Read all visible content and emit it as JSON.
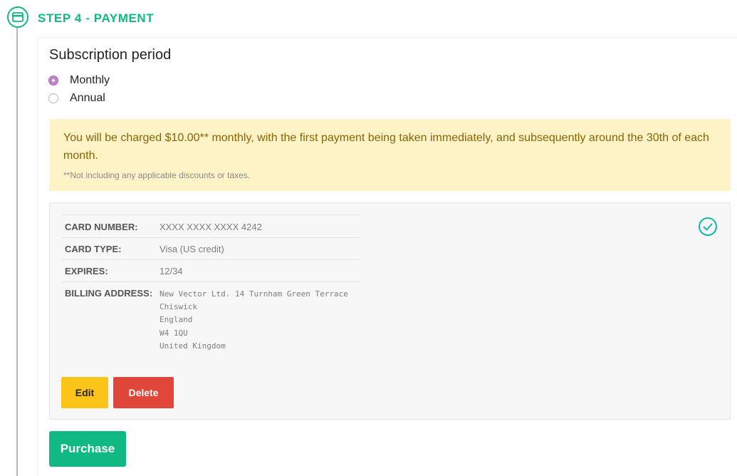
{
  "step": {
    "icon": "credit-card-icon",
    "title": "STEP 4 - PAYMENT"
  },
  "subscription": {
    "title": "Subscription period",
    "options": [
      {
        "label": "Monthly",
        "selected": true
      },
      {
        "label": "Annual",
        "selected": false
      }
    ]
  },
  "notice": {
    "message": "You will be charged $10.00** monthly, with the first payment being taken immediately, and subsequently around the 30th of each month.",
    "footnote": "**Not including any applicable discounts or taxes."
  },
  "card": {
    "rows": [
      {
        "label": "CARD NUMBER:",
        "value": "XXXX XXXX XXXX 4242"
      },
      {
        "label": "CARD TYPE:",
        "value": "Visa (US credit)"
      },
      {
        "label": "EXPIRES:",
        "value": "12/34"
      },
      {
        "label": "BILLING ADDRESS:",
        "value": "New Vector Ltd. 14 Turnham Green Terrace\nChiswick\nEngland\nW4 1QU\nUnited Kingdom"
      }
    ],
    "status_icon": "check-circle-icon",
    "edit_label": "Edit",
    "delete_label": "Delete"
  },
  "actions": {
    "purchase_label": "Purchase"
  },
  "colors": {
    "accent": "#10b981",
    "radio_selected": "#c084c8",
    "notice_bg": "#fef3c7",
    "notice_text": "#856404",
    "edit_button": "#fcc419",
    "delete_button": "#e0473a"
  }
}
